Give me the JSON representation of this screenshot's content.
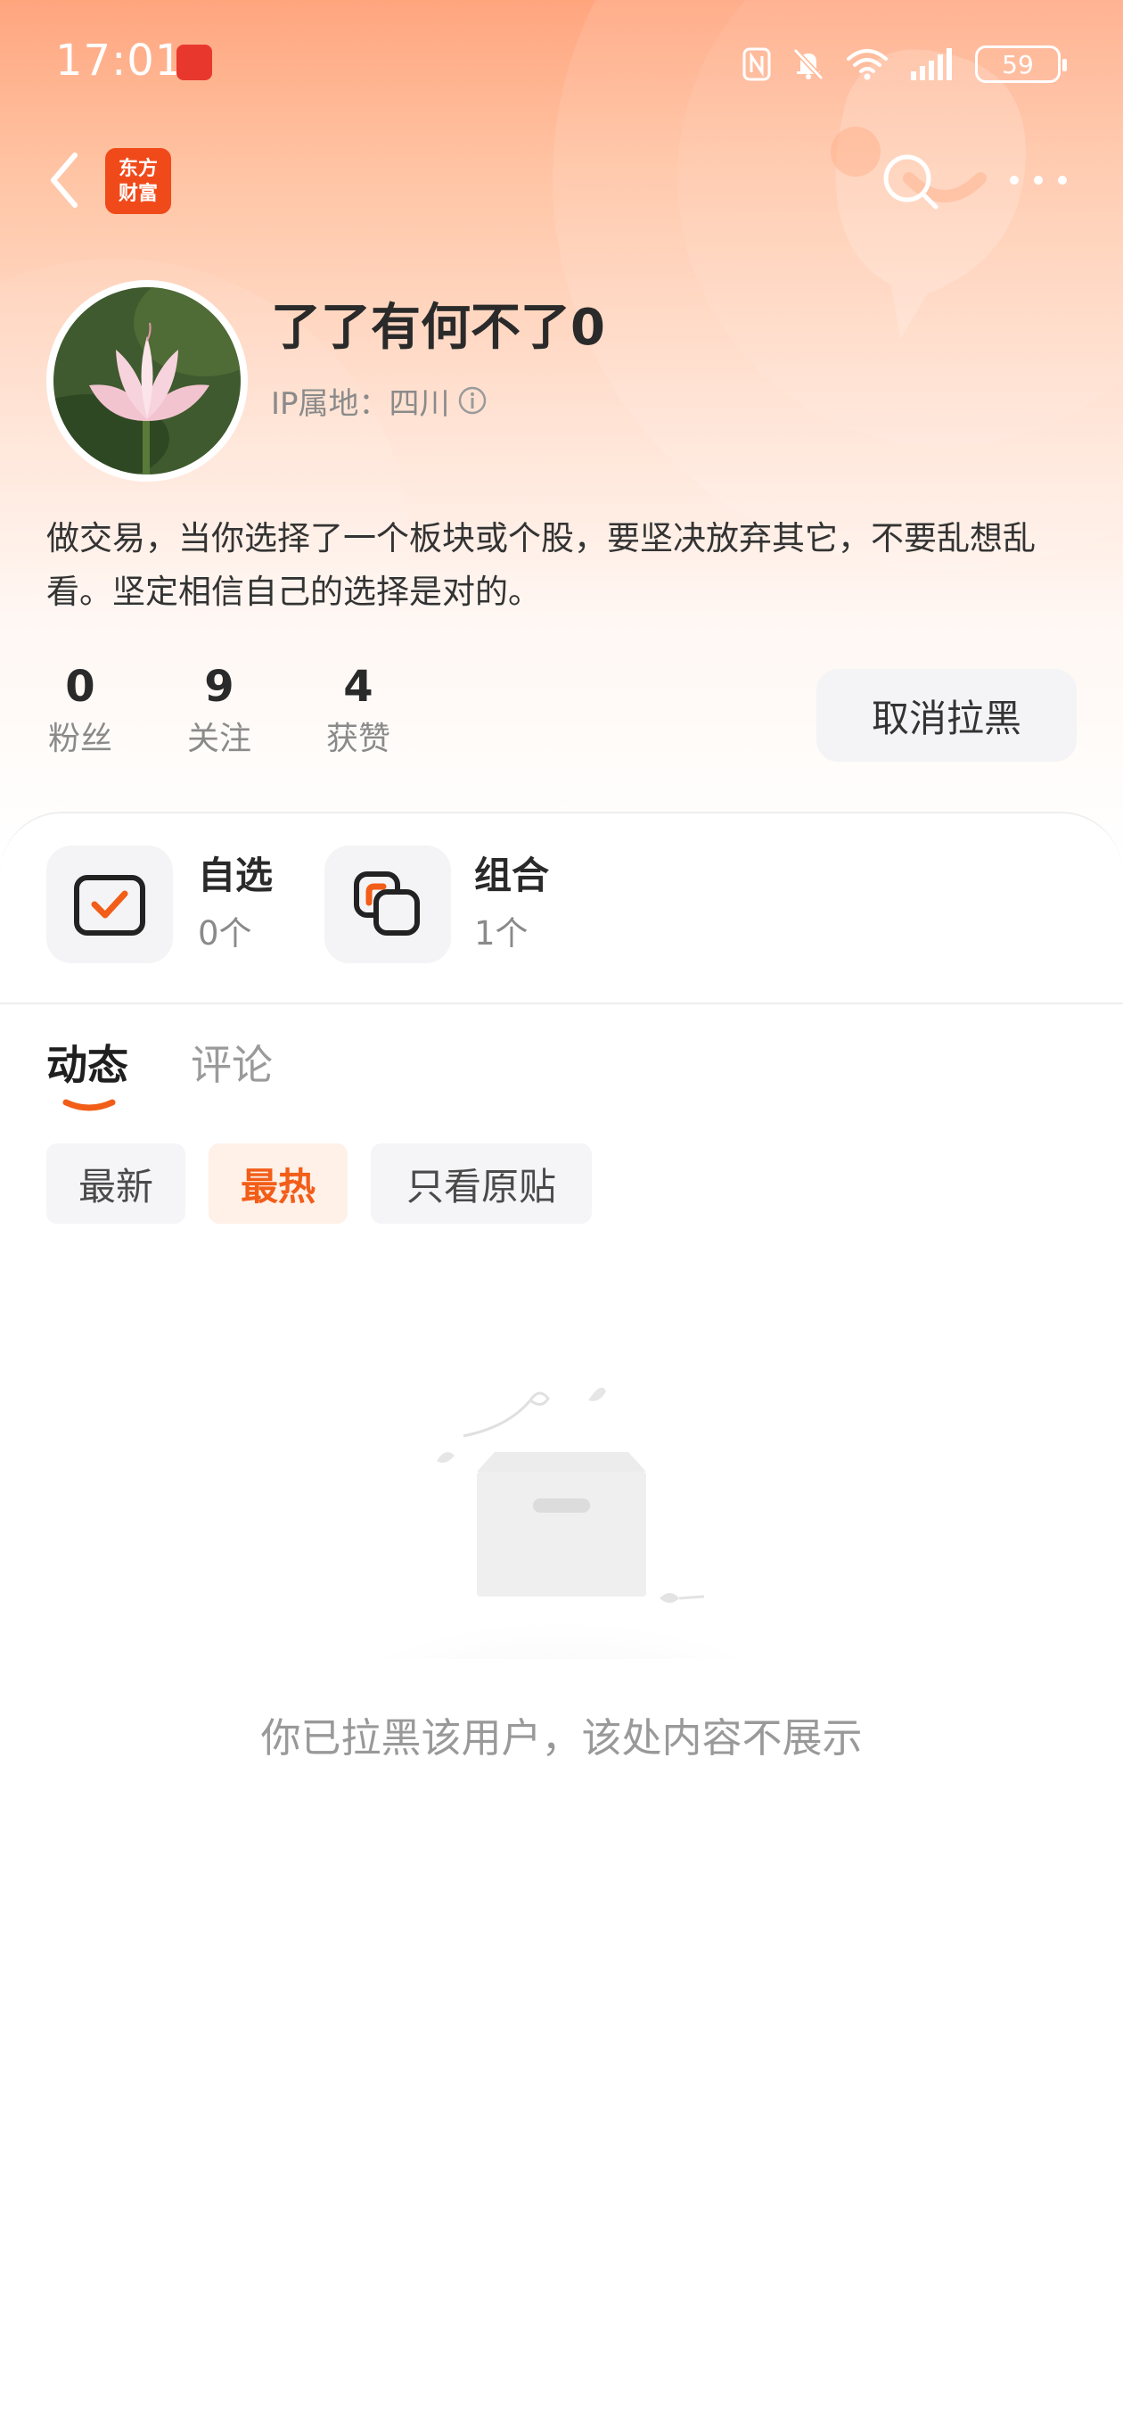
{
  "status_bar": {
    "time": "17:01",
    "battery": "59",
    "icons": [
      "app-notification-icon",
      "nfc-icon",
      "bell-muted-icon",
      "wifi-icon",
      "signal-icon",
      "battery-icon"
    ]
  },
  "nav": {
    "back_icon": "chevron-left-icon",
    "logo_line1": "东方",
    "logo_line2": "财富",
    "search_icon": "search-icon",
    "more_icon": "more-dots-icon"
  },
  "profile": {
    "username": "了了有何不了0",
    "ip_label": "IP属地：四川",
    "bio": "做交易，当你选择了一个板块或个股，要坚决放弃其它，不要乱想乱看。坚定相信自己的选择是对的。",
    "stats": [
      {
        "value": "0",
        "label": "粉丝"
      },
      {
        "value": "9",
        "label": "关注"
      },
      {
        "value": "4",
        "label": "获赞"
      }
    ],
    "unblock_label": "取消拉黑"
  },
  "features": [
    {
      "title": "自选",
      "count": "0个",
      "icon": "watchlist-check-icon"
    },
    {
      "title": "组合",
      "count": "1个",
      "icon": "portfolio-icon"
    }
  ],
  "tabs": [
    {
      "label": "动态",
      "active": true
    },
    {
      "label": "评论",
      "active": false
    }
  ],
  "filters": [
    {
      "label": "最新",
      "active": false
    },
    {
      "label": "最热",
      "active": true
    },
    {
      "label": "只看原贴",
      "active": false
    }
  ],
  "empty_state": {
    "message": "你已拉黑该用户，该处内容不展示"
  },
  "colors": {
    "accent": "#f25d18",
    "header_gradient_top": "#ffa57e",
    "logo_bg": "#f04a1a"
  }
}
